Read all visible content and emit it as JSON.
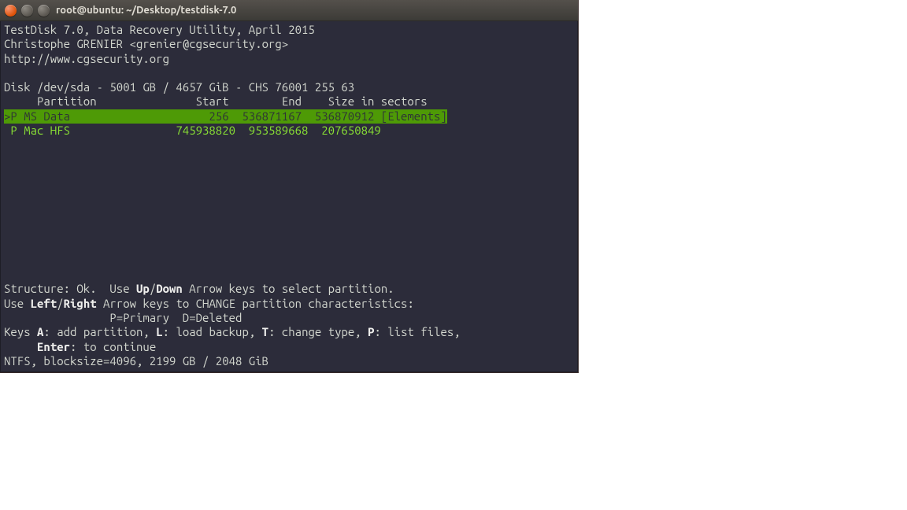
{
  "window": {
    "title": "root@ubuntu: ~/Desktop/testdisk-7.0"
  },
  "header": {
    "line1": "TestDisk 7.0, Data Recovery Utility, April 2015",
    "line2": "Christophe GRENIER <grenier@cgsecurity.org>",
    "line3": "http://www.cgsecurity.org"
  },
  "disk": {
    "info": "Disk /dev/sda - 5001 GB / 4657 GiB - CHS 76001 255 63",
    "columns": "     Partition               Start        End    Size in sectors"
  },
  "partitions": [
    {
      "selected": true,
      "raw": ">P MS Data                     256  536871167  536870912 [Elements]"
    },
    {
      "selected": false,
      "raw": " P Mac HFS                745938820  953589668  207650849"
    }
  ],
  "footer": {
    "struct_a": "Structure: Ok.  Use ",
    "struct_up": "Up",
    "struct_slash": "/",
    "struct_down": "Down",
    "struct_b": " Arrow keys to select partition.",
    "use_a": "Use ",
    "use_left": "Left",
    "use_slash": "/",
    "use_right": "Right",
    "use_b": " Arrow keys to CHANGE partition characteristics:",
    "legend": "                P=Primary  D=Deleted",
    "keys_a": "Keys ",
    "keys_A": "A",
    "keys_A_txt": ": add partition, ",
    "keys_L": "L",
    "keys_L_txt": ": load backup, ",
    "keys_T": "T",
    "keys_T_txt": ": change type, ",
    "keys_P": "P",
    "keys_P_txt": ": list files,",
    "enter_pad": "     ",
    "enter": "Enter",
    "enter_txt": ": to continue",
    "fsinfo": "NTFS, blocksize=4096, 2199 GB / 2048 GiB"
  }
}
